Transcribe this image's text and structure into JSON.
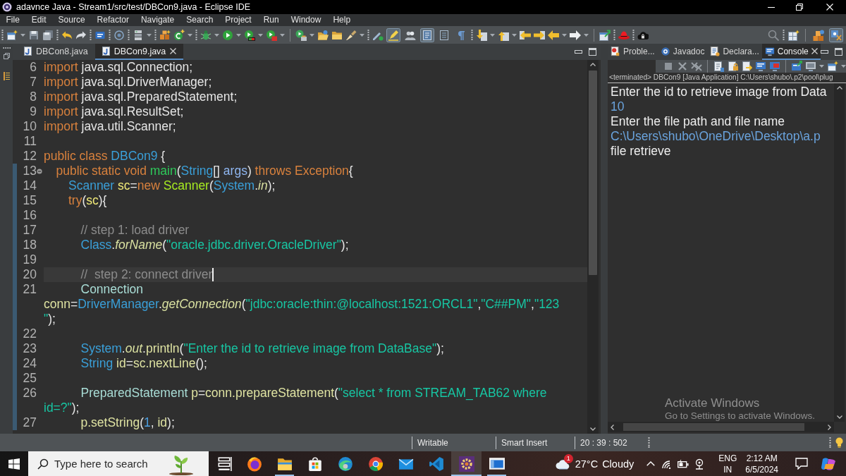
{
  "window": {
    "title": "adavnce Java - Stream1/src/test/DBCon9.java - Eclipse IDE"
  },
  "menu": [
    "File",
    "Edit",
    "Source",
    "Refactor",
    "Navigate",
    "Search",
    "Project",
    "Run",
    "Window",
    "Help"
  ],
  "toolbar": {
    "toggle_buttons": [
      {
        "kind": "highlight",
        "selected": true
      },
      {
        "kind": "group",
        "selected": false
      },
      {
        "kind": "frame",
        "selected": true
      },
      {
        "kind": "lines",
        "selected": false
      },
      {
        "kind": "pilcrow",
        "selected": false
      }
    ],
    "perspectives": [
      {
        "kind": "tools",
        "selected": false
      },
      {
        "kind": "java",
        "selected": true
      }
    ]
  },
  "editor": {
    "tabs": [
      {
        "label": "DBCon8.java",
        "selected": false
      },
      {
        "label": "DBCon9.java",
        "selected": true
      }
    ],
    "lines": [
      {
        "number": "6",
        "current": false,
        "fold": false,
        "tokens": [
          {
            "text": "import",
            "kind": "keyword"
          },
          {
            "text": " java.sql.Connection;",
            "kind": "plain"
          }
        ]
      },
      {
        "number": "7",
        "current": false,
        "fold": false,
        "tokens": [
          {
            "text": "import",
            "kind": "keyword"
          },
          {
            "text": " java.sql.DriverManager;",
            "kind": "plain"
          }
        ]
      },
      {
        "number": "8",
        "current": false,
        "fold": false,
        "tokens": [
          {
            "text": "import",
            "kind": "keyword"
          },
          {
            "text": " java.sql.PreparedStatement;",
            "kind": "plain"
          }
        ]
      },
      {
        "number": "9",
        "current": false,
        "fold": false,
        "tokens": [
          {
            "text": "import",
            "kind": "keyword"
          },
          {
            "text": " java.sql.ResultSet;",
            "kind": "plain"
          }
        ]
      },
      {
        "number": "10",
        "current": false,
        "fold": false,
        "tokens": [
          {
            "text": "import",
            "kind": "keyword"
          },
          {
            "text": " java.util.Scanner;",
            "kind": "plain"
          }
        ]
      },
      {
        "number": "11",
        "current": false,
        "fold": false
      },
      {
        "number": "12",
        "current": false,
        "fold": false,
        "tokens": [
          {
            "text": "public class",
            "kind": "keyword"
          },
          {
            "text": " DBCon9",
            "kind": "type"
          },
          {
            "text": " {",
            "kind": "plain"
          }
        ],
        "children": [
          {
            "number": "13",
            "current": false,
            "fold": true,
            "tokens": [
              {
                "text": "public static void",
                "kind": "keyword"
              },
              {
                "text": " main",
                "kind": "method_decl"
              },
              {
                "text": "(",
                "kind": "plain"
              },
              {
                "text": "String",
                "kind": "type"
              },
              {
                "text": "[] ",
                "kind": "plain"
              },
              {
                "text": "args",
                "kind": "param"
              },
              {
                "text": ") ",
                "kind": "plain"
              },
              {
                "text": "throws Exception",
                "kind": "keyword"
              },
              {
                "text": "{",
                "kind": "plain"
              }
            ],
            "children": [
              {
                "number": "14",
                "current": false,
                "fold": false,
                "tokens": [
                  {
                    "text": "Scanner",
                    "kind": "type"
                  },
                  {
                    "text": " sc",
                    "kind": "local"
                  },
                  {
                    "text": "=",
                    "kind": "plain"
                  },
                  {
                    "text": "new",
                    "kind": "keyword"
                  },
                  {
                    "text": " Scanner",
                    "kind": "constructor"
                  },
                  {
                    "text": "(",
                    "kind": "plain"
                  },
                  {
                    "text": "System",
                    "kind": "type"
                  },
                  {
                    "text": ".",
                    "kind": "plain"
                  },
                  {
                    "text": "in",
                    "kind": "static"
                  },
                  {
                    "text": ");",
                    "kind": "plain"
                  }
                ]
              },
              {
                "number": "15",
                "current": false,
                "fold": false,
                "tokens": [
                  {
                    "text": "try",
                    "kind": "keyword"
                  },
                  {
                    "text": "(",
                    "kind": "plain"
                  },
                  {
                    "text": "sc",
                    "kind": "local"
                  },
                  {
                    "text": "){",
                    "kind": "plain"
                  }
                ],
                "children": [
                  {
                    "number": "16",
                    "current": false,
                    "fold": false
                  },
                  {
                    "number": "17",
                    "current": false,
                    "fold": false,
                    "tokens": [
                      {
                        "text": "// step 1: load driver",
                        "kind": "comment"
                      }
                    ]
                  },
                  {
                    "number": "18",
                    "current": false,
                    "fold": false,
                    "tokens": [
                      {
                        "text": "Class",
                        "kind": "type"
                      },
                      {
                        "text": ".",
                        "kind": "plain"
                      },
                      {
                        "text": "forName",
                        "kind": "static"
                      },
                      {
                        "text": "(",
                        "kind": "plain"
                      },
                      {
                        "text": "\"oracle.jdbc.driver.OracleDriver\"",
                        "kind": "string"
                      },
                      {
                        "text": ");",
                        "kind": "plain"
                      }
                    ]
                  },
                  {
                    "number": "19",
                    "current": false,
                    "fold": false
                  },
                  {
                    "number": "20",
                    "current": true,
                    "fold": false,
                    "tokens": [
                      {
                        "text": "//  step 2: connect driver",
                        "kind": "comment"
                      }
                    ]
                  },
                  {
                    "number": "21",
                    "current": false,
                    "fold": false,
                    "tokens": [
                      {
                        "text": "Connection",
                        "kind": "interface"
                      },
                      {
                        "kind": "wrap"
                      },
                      {
                        "text": "conn",
                        "kind": "variable"
                      },
                      {
                        "text": "=",
                        "kind": "plain"
                      },
                      {
                        "text": "DriverManager",
                        "kind": "type"
                      },
                      {
                        "text": ".",
                        "kind": "plain"
                      },
                      {
                        "text": "getConnection",
                        "kind": "static"
                      },
                      {
                        "text": "(",
                        "kind": "plain"
                      },
                      {
                        "text": "\"jdbc:oracle:thin:@localhost:1521:ORCL1\"",
                        "kind": "string"
                      },
                      {
                        "text": ",",
                        "kind": "plain"
                      },
                      {
                        "text": "\"C##PM\"",
                        "kind": "string"
                      },
                      {
                        "text": ",",
                        "kind": "plain"
                      },
                      {
                        "text": "\"123",
                        "kind": "string"
                      },
                      {
                        "kind": "wrap"
                      },
                      {
                        "text": "\"",
                        "kind": "string"
                      },
                      {
                        "text": ");",
                        "kind": "plain"
                      }
                    ]
                  },
                  {
                    "number": "22",
                    "current": false,
                    "fold": false
                  },
                  {
                    "number": "23",
                    "current": false,
                    "fold": false,
                    "tokens": [
                      {
                        "text": "System",
                        "kind": "type"
                      },
                      {
                        "text": ".",
                        "kind": "plain"
                      },
                      {
                        "text": "out",
                        "kind": "static"
                      },
                      {
                        "text": ".",
                        "kind": "plain"
                      },
                      {
                        "text": "println",
                        "kind": "variable"
                      },
                      {
                        "text": "(",
                        "kind": "plain"
                      },
                      {
                        "text": "\"Enter the id to retrieve image from DataBase\"",
                        "kind": "string"
                      },
                      {
                        "text": ");",
                        "kind": "plain"
                      }
                    ]
                  },
                  {
                    "number": "24",
                    "current": false,
                    "fold": false,
                    "tokens": [
                      {
                        "text": "String",
                        "kind": "type"
                      },
                      {
                        "text": " id",
                        "kind": "variable"
                      },
                      {
                        "text": "=",
                        "kind": "plain"
                      },
                      {
                        "text": "sc.nextLine",
                        "kind": "variable"
                      },
                      {
                        "text": "();",
                        "kind": "plain"
                      }
                    ]
                  },
                  {
                    "number": "25",
                    "current": false,
                    "fold": false
                  },
                  {
                    "number": "26",
                    "current": false,
                    "fold": false,
                    "tokens": [
                      {
                        "text": "PreparedStatement",
                        "kind": "interface"
                      },
                      {
                        "text": " p",
                        "kind": "variable"
                      },
                      {
                        "text": "=",
                        "kind": "plain"
                      },
                      {
                        "text": "conn.prepareStatement",
                        "kind": "variable"
                      },
                      {
                        "text": "(",
                        "kind": "plain"
                      },
                      {
                        "text": "\"select * from STREAM_TAB62 where",
                        "kind": "string"
                      },
                      {
                        "kind": "wrap"
                      },
                      {
                        "text": "id=?\"",
                        "kind": "string"
                      },
                      {
                        "text": ");",
                        "kind": "plain"
                      }
                    ]
                  },
                  {
                    "number": "27",
                    "current": false,
                    "fold": false,
                    "tokens": [
                      {
                        "text": "p.setString",
                        "kind": "variable"
                      },
                      {
                        "text": "(",
                        "kind": "plain"
                      },
                      {
                        "text": "1",
                        "kind": "number"
                      },
                      {
                        "text": ", ",
                        "kind": "plain"
                      },
                      {
                        "text": "id",
                        "kind": "variable"
                      },
                      {
                        "text": ");",
                        "kind": "plain"
                      }
                    ]
                  }
                ]
              }
            ]
          }
        ]
      }
    ]
  },
  "side_panel": {
    "tabs": [
      {
        "label": "Proble...",
        "kind": "problems",
        "selected": false
      },
      {
        "label": "Javadoc",
        "kind": "javadoc",
        "selected": false
      },
      {
        "label": "Declara...",
        "kind": "declaration",
        "selected": false
      },
      {
        "label": "Console",
        "kind": "console",
        "selected": true
      }
    ],
    "console": {
      "status": "<terminated> DBCon9 [Java Application] C:\\Users\\shubo\\.p2\\pool\\plug",
      "output": [
        {
          "text": "Enter the id to retrieve image from Data",
          "kind": "output"
        },
        {
          "text": "10",
          "kind": "input"
        },
        {
          "text": "Enter the file path and file name",
          "kind": "output"
        },
        {
          "text": "C:\\Users\\shubo\\OneDrive\\Desktop\\a.p",
          "kind": "input"
        },
        {
          "text": "file retrieve",
          "kind": "output"
        }
      ]
    }
  },
  "activation_notice": {
    "title": "Activate Windows",
    "message": "Go to Settings to activate Windows."
  },
  "status_bar": {
    "mode": "Writable",
    "insert_mode": "Smart Insert",
    "position": "20 : 39 : 502"
  },
  "taskbar": {
    "search": {
      "placeholder": "Type here to search"
    },
    "apps": [
      {
        "kind": "task_view",
        "selected": false,
        "running": false
      },
      {
        "kind": "firefox",
        "selected": false,
        "running": false
      },
      {
        "kind": "files",
        "selected": false,
        "running": true
      },
      {
        "kind": "store",
        "selected": false,
        "running": false
      },
      {
        "kind": "edge",
        "selected": false,
        "running": false
      },
      {
        "kind": "chrome",
        "selected": false,
        "running": false
      },
      {
        "kind": "mail",
        "selected": false,
        "running": false
      },
      {
        "kind": "vscode",
        "selected": false,
        "running": false
      },
      {
        "kind": "eclipse",
        "selected": true,
        "running": true
      },
      {
        "kind": "window",
        "selected": false,
        "running": true
      }
    ],
    "weather": {
      "badge": "1",
      "temperature": "27°C",
      "condition": "Cloudy"
    },
    "language": {
      "code": "ENG",
      "region": "IN"
    },
    "clock": {
      "time": "2:12 AM",
      "date": "6/5/2024"
    }
  }
}
